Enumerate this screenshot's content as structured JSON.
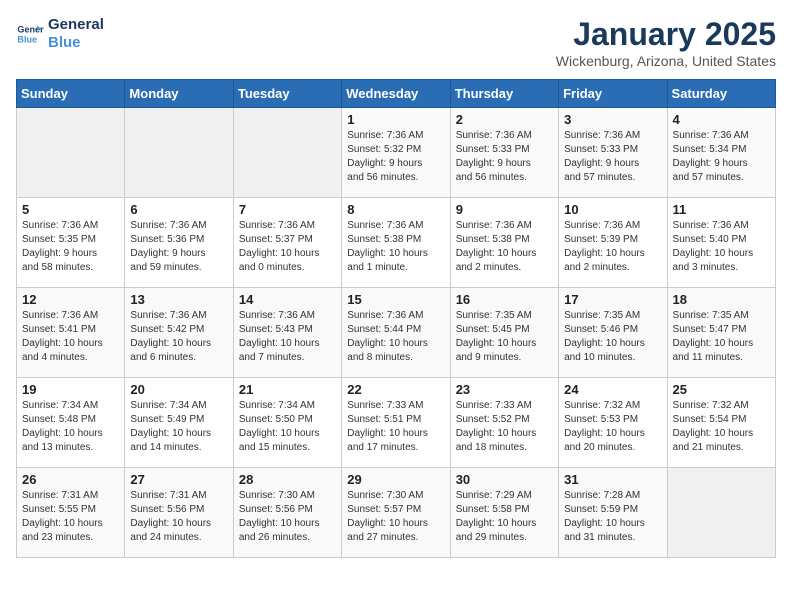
{
  "header": {
    "logo_line1": "General",
    "logo_line2": "Blue",
    "month": "January 2025",
    "location": "Wickenburg, Arizona, United States"
  },
  "weekdays": [
    "Sunday",
    "Monday",
    "Tuesday",
    "Wednesday",
    "Thursday",
    "Friday",
    "Saturday"
  ],
  "weeks": [
    [
      {
        "num": "",
        "info": ""
      },
      {
        "num": "",
        "info": ""
      },
      {
        "num": "",
        "info": ""
      },
      {
        "num": "1",
        "info": "Sunrise: 7:36 AM\nSunset: 5:32 PM\nDaylight: 9 hours\nand 56 minutes."
      },
      {
        "num": "2",
        "info": "Sunrise: 7:36 AM\nSunset: 5:33 PM\nDaylight: 9 hours\nand 56 minutes."
      },
      {
        "num": "3",
        "info": "Sunrise: 7:36 AM\nSunset: 5:33 PM\nDaylight: 9 hours\nand 57 minutes."
      },
      {
        "num": "4",
        "info": "Sunrise: 7:36 AM\nSunset: 5:34 PM\nDaylight: 9 hours\nand 57 minutes."
      }
    ],
    [
      {
        "num": "5",
        "info": "Sunrise: 7:36 AM\nSunset: 5:35 PM\nDaylight: 9 hours\nand 58 minutes."
      },
      {
        "num": "6",
        "info": "Sunrise: 7:36 AM\nSunset: 5:36 PM\nDaylight: 9 hours\nand 59 minutes."
      },
      {
        "num": "7",
        "info": "Sunrise: 7:36 AM\nSunset: 5:37 PM\nDaylight: 10 hours\nand 0 minutes."
      },
      {
        "num": "8",
        "info": "Sunrise: 7:36 AM\nSunset: 5:38 PM\nDaylight: 10 hours\nand 1 minute."
      },
      {
        "num": "9",
        "info": "Sunrise: 7:36 AM\nSunset: 5:38 PM\nDaylight: 10 hours\nand 2 minutes."
      },
      {
        "num": "10",
        "info": "Sunrise: 7:36 AM\nSunset: 5:39 PM\nDaylight: 10 hours\nand 2 minutes."
      },
      {
        "num": "11",
        "info": "Sunrise: 7:36 AM\nSunset: 5:40 PM\nDaylight: 10 hours\nand 3 minutes."
      }
    ],
    [
      {
        "num": "12",
        "info": "Sunrise: 7:36 AM\nSunset: 5:41 PM\nDaylight: 10 hours\nand 4 minutes."
      },
      {
        "num": "13",
        "info": "Sunrise: 7:36 AM\nSunset: 5:42 PM\nDaylight: 10 hours\nand 6 minutes."
      },
      {
        "num": "14",
        "info": "Sunrise: 7:36 AM\nSunset: 5:43 PM\nDaylight: 10 hours\nand 7 minutes."
      },
      {
        "num": "15",
        "info": "Sunrise: 7:36 AM\nSunset: 5:44 PM\nDaylight: 10 hours\nand 8 minutes."
      },
      {
        "num": "16",
        "info": "Sunrise: 7:35 AM\nSunset: 5:45 PM\nDaylight: 10 hours\nand 9 minutes."
      },
      {
        "num": "17",
        "info": "Sunrise: 7:35 AM\nSunset: 5:46 PM\nDaylight: 10 hours\nand 10 minutes."
      },
      {
        "num": "18",
        "info": "Sunrise: 7:35 AM\nSunset: 5:47 PM\nDaylight: 10 hours\nand 11 minutes."
      }
    ],
    [
      {
        "num": "19",
        "info": "Sunrise: 7:34 AM\nSunset: 5:48 PM\nDaylight: 10 hours\nand 13 minutes."
      },
      {
        "num": "20",
        "info": "Sunrise: 7:34 AM\nSunset: 5:49 PM\nDaylight: 10 hours\nand 14 minutes."
      },
      {
        "num": "21",
        "info": "Sunrise: 7:34 AM\nSunset: 5:50 PM\nDaylight: 10 hours\nand 15 minutes."
      },
      {
        "num": "22",
        "info": "Sunrise: 7:33 AM\nSunset: 5:51 PM\nDaylight: 10 hours\nand 17 minutes."
      },
      {
        "num": "23",
        "info": "Sunrise: 7:33 AM\nSunset: 5:52 PM\nDaylight: 10 hours\nand 18 minutes."
      },
      {
        "num": "24",
        "info": "Sunrise: 7:32 AM\nSunset: 5:53 PM\nDaylight: 10 hours\nand 20 minutes."
      },
      {
        "num": "25",
        "info": "Sunrise: 7:32 AM\nSunset: 5:54 PM\nDaylight: 10 hours\nand 21 minutes."
      }
    ],
    [
      {
        "num": "26",
        "info": "Sunrise: 7:31 AM\nSunset: 5:55 PM\nDaylight: 10 hours\nand 23 minutes."
      },
      {
        "num": "27",
        "info": "Sunrise: 7:31 AM\nSunset: 5:56 PM\nDaylight: 10 hours\nand 24 minutes."
      },
      {
        "num": "28",
        "info": "Sunrise: 7:30 AM\nSunset: 5:56 PM\nDaylight: 10 hours\nand 26 minutes."
      },
      {
        "num": "29",
        "info": "Sunrise: 7:30 AM\nSunset: 5:57 PM\nDaylight: 10 hours\nand 27 minutes."
      },
      {
        "num": "30",
        "info": "Sunrise: 7:29 AM\nSunset: 5:58 PM\nDaylight: 10 hours\nand 29 minutes."
      },
      {
        "num": "31",
        "info": "Sunrise: 7:28 AM\nSunset: 5:59 PM\nDaylight: 10 hours\nand 31 minutes."
      },
      {
        "num": "",
        "info": ""
      }
    ]
  ]
}
